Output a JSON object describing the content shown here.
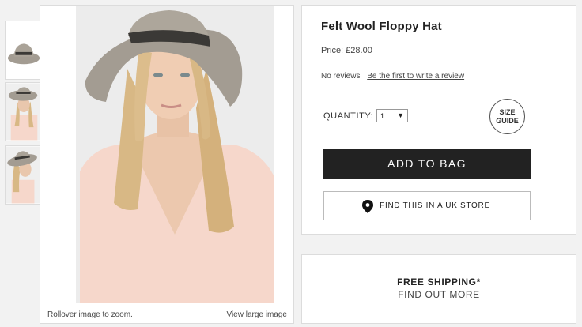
{
  "thumbnails": [
    {
      "alt": "hat-only"
    },
    {
      "alt": "model-front"
    },
    {
      "alt": "model-side"
    }
  ],
  "gallery": {
    "rollover_text": "Rollover image to zoom.",
    "view_large_text": "View large image"
  },
  "product": {
    "title": "Felt Wool Floppy Hat",
    "price": "Price: £28.00",
    "reviews_count": "No reviews",
    "write_review": "Be the first to write a review",
    "quantity_label": "QUANTITY:",
    "quantity_value": "1",
    "size_guide_line1": "SIZE",
    "size_guide_line2": "GUIDE",
    "add_to_bag": "ADD TO BAG",
    "find_store": "FIND THIS IN A UK STORE"
  },
  "shipping": {
    "title": "FREE SHIPPING*",
    "subtitle": "FIND OUT MORE"
  },
  "colors": {
    "button_dark": "#222222",
    "page_bg": "#f2f2f2",
    "hat": "#a39c92",
    "hat_band": "#3b3936",
    "top": "#f6d7cb",
    "hair": "#d8b885"
  }
}
